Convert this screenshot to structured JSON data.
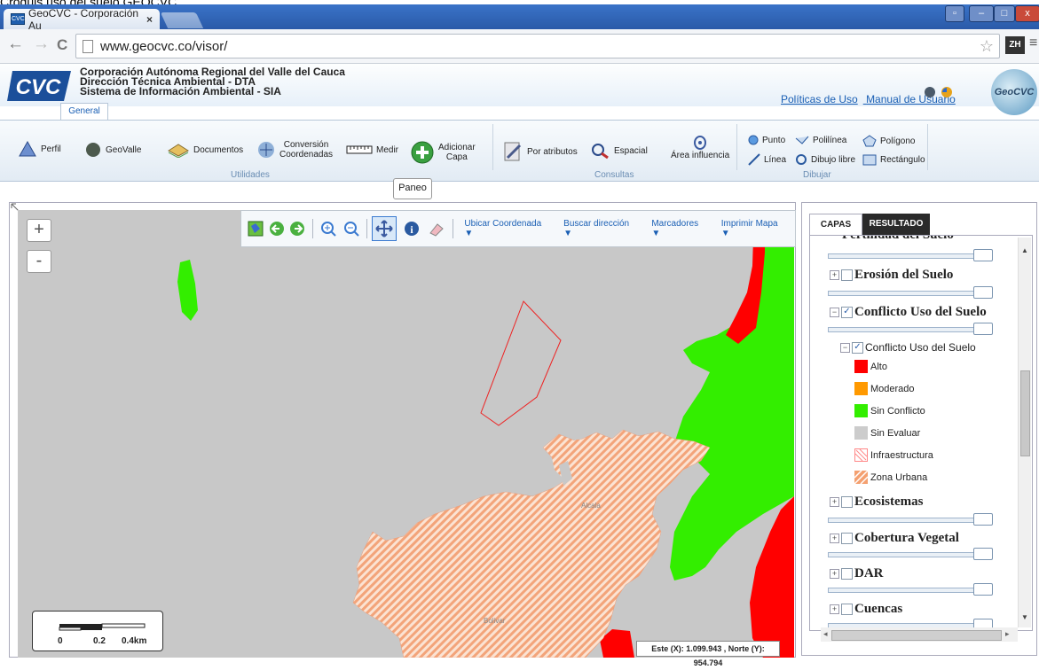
{
  "caption": "Croquis uso del suelo GEOCVC.",
  "browser": {
    "tab_title": "GeoCVC - Corporación Au",
    "tab_close": "×",
    "favicon": "CVC",
    "url": "www.geocvc.co/visor/",
    "profile": "ZH",
    "back": "←",
    "forward": "→",
    "reload": "C",
    "star": "☆",
    "menu": "≡",
    "win_min": "–",
    "win_max": "□",
    "win_close": "x"
  },
  "header": {
    "logo": "CVC",
    "org_line1": "Corporación Autónoma Regional del Valle del Cauca",
    "org_line2": "Dirección Técnica Ambiental - DTA",
    "org_line3": "Sistema de Información Ambiental - SIA",
    "link_policies": "Políticas de Uso",
    "link_manual": "Manual de Usuario",
    "geocvc_logo": "GeoCVC",
    "general_tab": "General"
  },
  "toolbar": {
    "perfil": "Perfil",
    "geovalle": "GeoValle",
    "documentos": "Documentos",
    "conversion_l1": "Conversión",
    "conversion_l2": "Coordenadas",
    "medir": "Medir",
    "adicionar_l1": "Adicionar",
    "adicionar_l2": "Capa",
    "group_utilidades": "Utilidades",
    "por_atributos": "Por atributos",
    "espacial": "Espacial",
    "area_influencia": "Área influencia",
    "group_consultas": "Consultas",
    "punto": "Punto",
    "linea": "Línea",
    "polilinea": "Polilínea",
    "dibujo_libre": "Dibujo libre",
    "poligono": "Polígono",
    "rectangulo": "Rectángulo",
    "group_dibujar": "Dibujar"
  },
  "map": {
    "tooltip": "Paneo",
    "zoom_in": "+",
    "zoom_out": "-",
    "ubicar": "Ubicar Coordenada ▼",
    "buscar": "Buscar dirección ▼",
    "marcadores": "Marcadores ▼",
    "imprimir": "Imprimir Mapa ▼",
    "scale_0": "0",
    "scale_1": "0.2",
    "scale_2": "0.4km",
    "coords": "Este (X): 1.099.943 , Norte (Y): 954.794",
    "label_a": "Alcala",
    "label_b": "Bolivar"
  },
  "panel": {
    "tab_capas": "CAPAS",
    "tab_resultado": "RESULTADO",
    "layer_partial": "Fertilidad del Suelo",
    "layers": [
      {
        "name": "Erosión del Suelo",
        "expanded": false,
        "checked": false
      },
      {
        "name": "Conflicto Uso del Suelo",
        "expanded": true,
        "checked": true
      },
      {
        "name": "Ecosistemas",
        "expanded": false,
        "checked": false
      },
      {
        "name": "Cobertura Vegetal",
        "expanded": false,
        "checked": false
      },
      {
        "name": "DAR",
        "expanded": false,
        "checked": false
      },
      {
        "name": "Cuencas",
        "expanded": false,
        "checked": false
      }
    ],
    "sublayer": "Conflicto Uso del Suelo",
    "legend": [
      {
        "label": "Alto",
        "color": "#ff0000"
      },
      {
        "label": "Moderado",
        "color": "#ff9900"
      },
      {
        "label": "Sin Conflicto",
        "color": "#33ee00"
      },
      {
        "label": "Sin Evaluar",
        "color": "#cccccc"
      },
      {
        "label": "Infraestructura",
        "color": "#ff9999"
      },
      {
        "label": "Zona Urbana",
        "color": "#f4a070"
      }
    ]
  }
}
